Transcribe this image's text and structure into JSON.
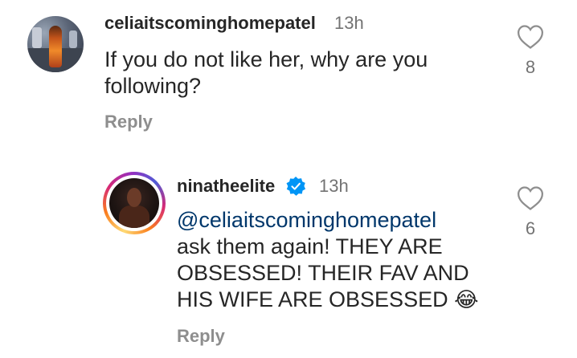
{
  "comments": [
    {
      "username": "celiaitscominghomepatel",
      "time": "13h",
      "text_lines": [
        "If you do not like her, why are you",
        "following?"
      ],
      "reply_label": "Reply",
      "likes": "8"
    },
    {
      "username": "ninatheelite",
      "verified": true,
      "time": "13h",
      "mention": "@celiaitscominghomepatel",
      "text_lines": [
        "ask them again! THEY ARE",
        "OBSESSED! THEIR FAV AND",
        "HIS WIFE ARE OBSESSED"
      ],
      "emoji": "😂",
      "reply_label": "Reply",
      "likes": "6"
    }
  ],
  "colors": {
    "verified_blue": "#0095f6",
    "mention": "#00376b",
    "meta_gray": "#737373"
  }
}
